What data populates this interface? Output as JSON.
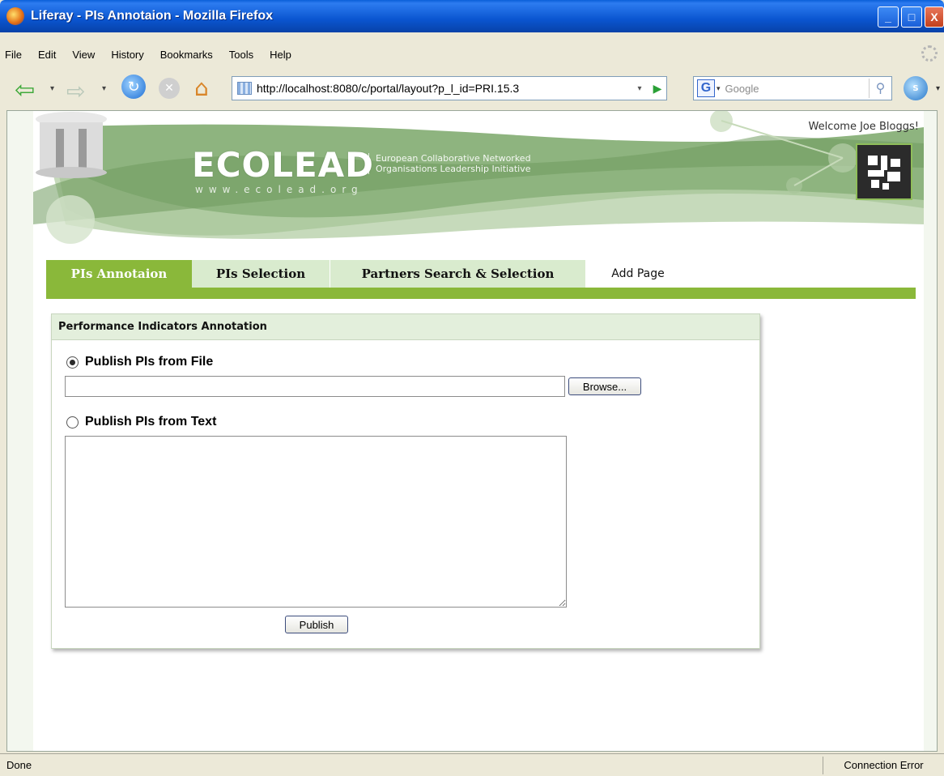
{
  "window": {
    "title": "Liferay - PIs Annotaion - Mozilla Firefox",
    "minimize": "_",
    "maximize": "□",
    "close": "X"
  },
  "menu": {
    "items": [
      "File",
      "Edit",
      "View",
      "History",
      "Bookmarks",
      "Tools",
      "Help"
    ]
  },
  "navbar": {
    "url": "http://localhost:8080/c/portal/layout?p_l_id=PRI.15.3",
    "search_placeholder": "Google",
    "search_engine_glyph": "G"
  },
  "banner": {
    "welcome": "Welcome Joe Bloggs!",
    "brand": "ECOLEAD",
    "brand_url": "www.ecolead.org",
    "tagline_line1": "European Collaborative Networked",
    "tagline_line2": "Organisations Leadership Initiative"
  },
  "tabs": [
    {
      "label": "PIs Annotaion",
      "active": true
    },
    {
      "label": "PIs Selection",
      "active": false
    },
    {
      "label": "Partners Search & Selection",
      "active": false
    },
    {
      "label": "Add Page",
      "active": false
    }
  ],
  "portlet": {
    "title": "Performance Indicators Annotation",
    "option_file": "Publish PIs from File",
    "option_text": "Publish PIs from Text",
    "selected_option": "file",
    "file_value": "",
    "text_value": "",
    "browse_label": "Browse...",
    "publish_label": "Publish"
  },
  "status": {
    "left": "Done",
    "right": "Connection Error"
  },
  "colors": {
    "accent_green": "#8ab83a",
    "tab_bg": "#d9ebce",
    "banner_green": "#7faa6a"
  }
}
